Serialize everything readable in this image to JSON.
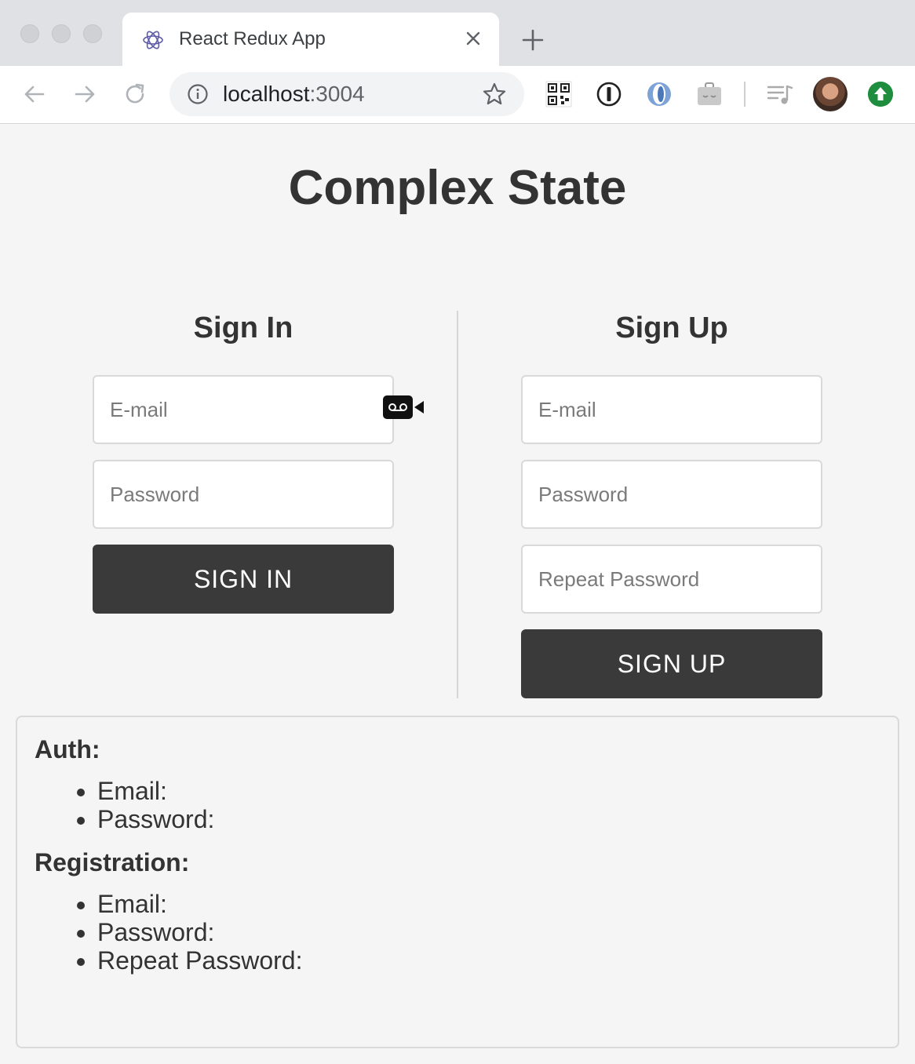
{
  "browser": {
    "tab_title": "React Redux App",
    "url_host": "localhost",
    "url_port": ":3004",
    "icons": [
      "react-favicon-icon",
      "close-icon",
      "plus-icon",
      "back-icon",
      "forward-icon",
      "reload-icon",
      "info-icon",
      "star-icon",
      "qr-code-icon",
      "password-manager-icon",
      "extension-icon",
      "briefcase-icon",
      "playlist-icon",
      "avatar",
      "update-icon"
    ]
  },
  "page": {
    "title": "Complex State"
  },
  "sign_in": {
    "title": "Sign In",
    "email_placeholder": "E-mail",
    "password_placeholder": "Password",
    "button_label": "SIGN IN"
  },
  "sign_up": {
    "title": "Sign Up",
    "email_placeholder": "E-mail",
    "password_placeholder": "Password",
    "repeat_password_placeholder": "Repeat Password",
    "button_label": "SIGN UP"
  },
  "state": {
    "auth": {
      "heading": "Auth:",
      "items": [
        "Email:",
        "Password:"
      ]
    },
    "registration": {
      "heading": "Registration:",
      "items": [
        "Email:",
        "Password:",
        "Repeat Password:"
      ]
    }
  },
  "colors": {
    "button": "#3a3a3a",
    "page_bg": "#f5f5f5",
    "update_badge": "#1e8e3e"
  }
}
